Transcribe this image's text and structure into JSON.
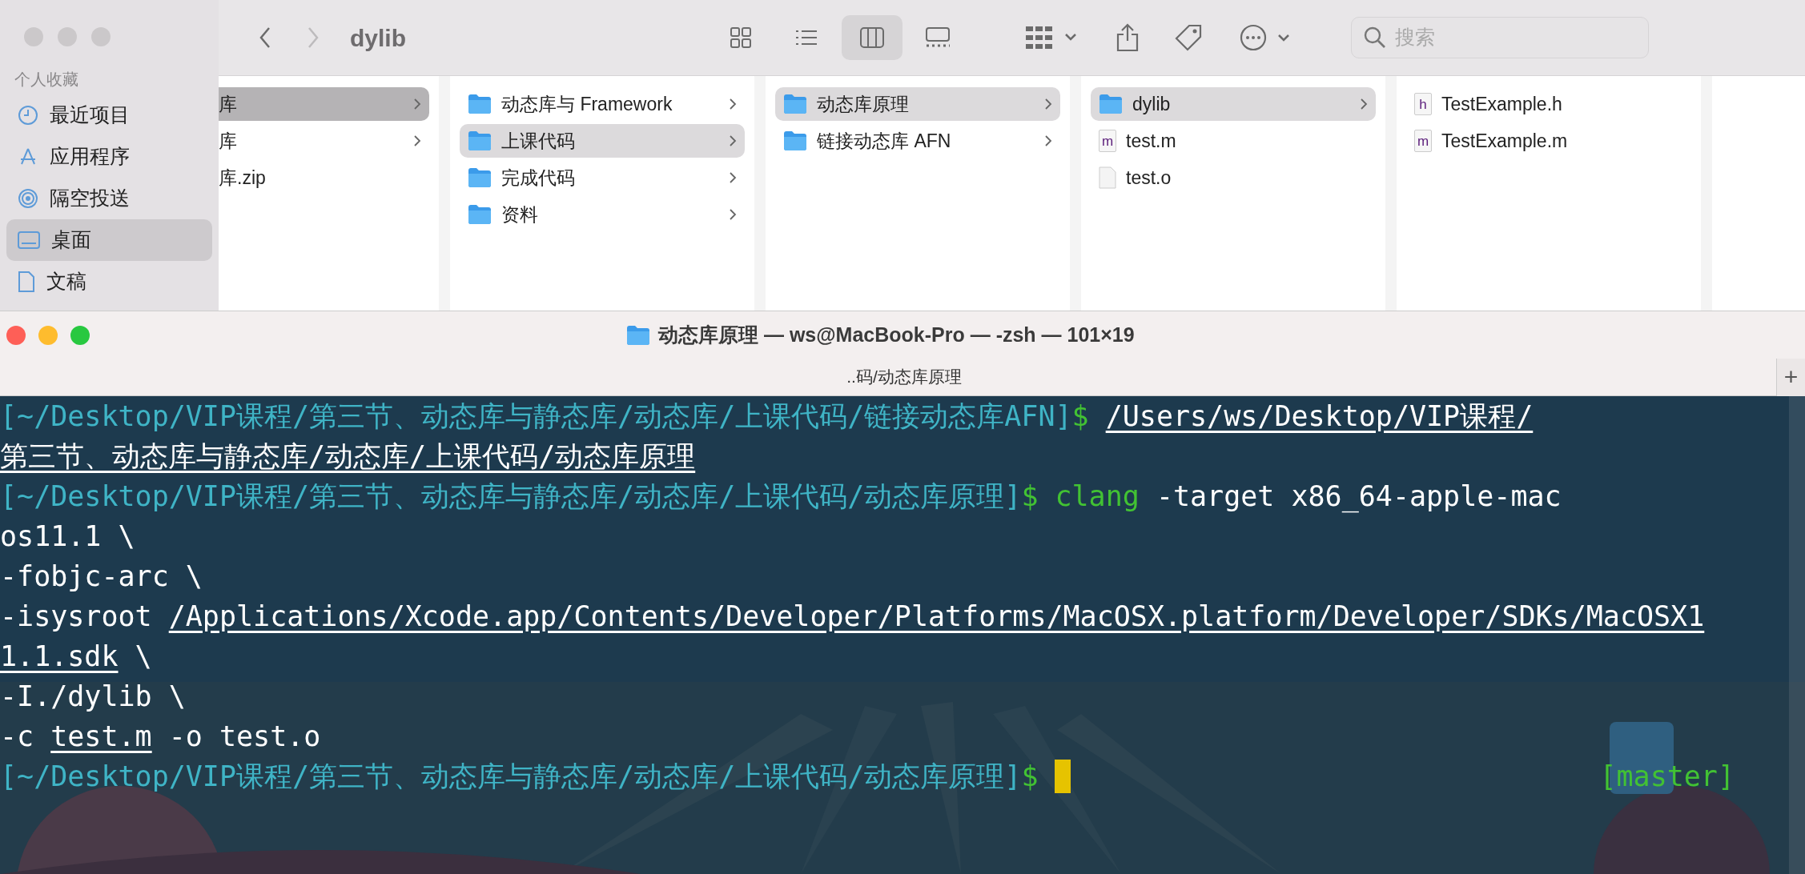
{
  "finder": {
    "title": "dylib",
    "nav": [
      {
        "kind": "back",
        "disabled": false
      },
      {
        "kind": "forward",
        "disabled": true
      }
    ],
    "views": [
      {
        "kind": "icons",
        "selected": false
      },
      {
        "kind": "list",
        "selected": false
      },
      {
        "kind": "columns",
        "selected": true
      },
      {
        "kind": "gallery",
        "selected": false
      }
    ],
    "search": {
      "placeholder": "搜索"
    },
    "sidebar": {
      "heading": "个人收藏",
      "items": [
        {
          "label": "最近项目",
          "selected": false
        },
        {
          "label": "应用程序",
          "selected": false
        },
        {
          "label": "隔空投送",
          "selected": false
        },
        {
          "label": "桌面",
          "selected": true
        },
        {
          "label": "文稿",
          "selected": false
        }
      ]
    },
    "columns": [
      {
        "items": [
          {
            "label": "库",
            "kind": "plain-folder",
            "selected": true
          },
          {
            "label": "库",
            "kind": "plain-folder",
            "selected": false
          },
          {
            "label": "库.zip",
            "kind": "plain",
            "selected": false
          }
        ]
      },
      {
        "items": [
          {
            "label": "动态库与 Framework",
            "kind": "folder",
            "selected": false
          },
          {
            "label": "上课代码",
            "kind": "folder",
            "selected": true
          },
          {
            "label": "完成代码",
            "kind": "folder",
            "selected": false
          },
          {
            "label": "资料",
            "kind": "folder",
            "selected": false
          }
        ]
      },
      {
        "items": [
          {
            "label": "动态库原理",
            "kind": "folder",
            "selected": true
          },
          {
            "label": "链接动态库 AFN",
            "kind": "folder",
            "selected": false
          }
        ]
      },
      {
        "items": [
          {
            "label": "dylib",
            "kind": "folder",
            "selected": true
          },
          {
            "label": "test.m",
            "kind": "source",
            "badge": "m",
            "selected": false
          },
          {
            "label": "test.o",
            "kind": "file",
            "selected": false
          }
        ]
      },
      {
        "items": [
          {
            "label": "TestExample.h",
            "kind": "source",
            "badge": "h",
            "selected": false
          },
          {
            "label": "TestExample.m",
            "kind": "source",
            "badge": "m",
            "selected": false
          }
        ]
      }
    ]
  },
  "terminal": {
    "title": "动态库原理 — ws@MacBook-Pro — -zsh — 101×19",
    "tab": "..码/动态库原理",
    "new_tab": "+",
    "lines": [
      [
        {
          "kind": "prompt",
          "text": "[~/Desktop/VIP课程/第三节、动态库与静态库/动态库/上课代码/链接动态库AFN]"
        },
        {
          "kind": "dollar",
          "text": "$"
        },
        {
          "kind": "gap"
        },
        {
          "kind": "path",
          "text": "/Users/ws/Desktop/VIP课程/"
        }
      ],
      [
        {
          "kind": "path",
          "text": "第三节、动态库与静态库/动态库/上课代码/动态库原理"
        }
      ],
      [
        {
          "kind": "prompt",
          "text": "[~/Desktop/VIP课程/第三节、动态库与静态库/动态库/上课代码/动态库原理]"
        },
        {
          "kind": "dollar",
          "text": "$"
        },
        {
          "kind": "gap"
        },
        {
          "kind": "command",
          "text": "clang"
        },
        {
          "kind": "plain",
          "text": " -target x86_64-apple-mac"
        }
      ],
      [
        {
          "kind": "plain",
          "text": "os11.1 \\"
        }
      ],
      [
        {
          "kind": "plain",
          "text": "-fobjc-arc \\"
        }
      ],
      [
        {
          "kind": "plain",
          "text": "-isysroot "
        },
        {
          "kind": "path",
          "text": "/Applications/Xcode.app/Contents/Developer/Platforms/MacOSX.platform/Developer/SDKs/MacOSX1"
        }
      ],
      [
        {
          "kind": "path",
          "text": "1.1.sdk"
        },
        {
          "kind": "plain",
          "text": " \\"
        }
      ],
      [
        {
          "kind": "plain",
          "text": "-I./dylib \\"
        }
      ],
      [
        {
          "kind": "plain",
          "text": "-c "
        },
        {
          "kind": "path",
          "text": "test.m"
        },
        {
          "kind": "plain",
          "text": " -o test.o"
        }
      ],
      [
        {
          "kind": "prompt",
          "text": "[~/Desktop/VIP课程/第三节、动态库与静态库/动态库/上课代码/动态库原理]"
        },
        {
          "kind": "dollar",
          "text": "$"
        },
        {
          "kind": "gap"
        },
        {
          "kind": "cursor"
        },
        {
          "kind": "branch",
          "text": "[master]"
        }
      ]
    ]
  }
}
